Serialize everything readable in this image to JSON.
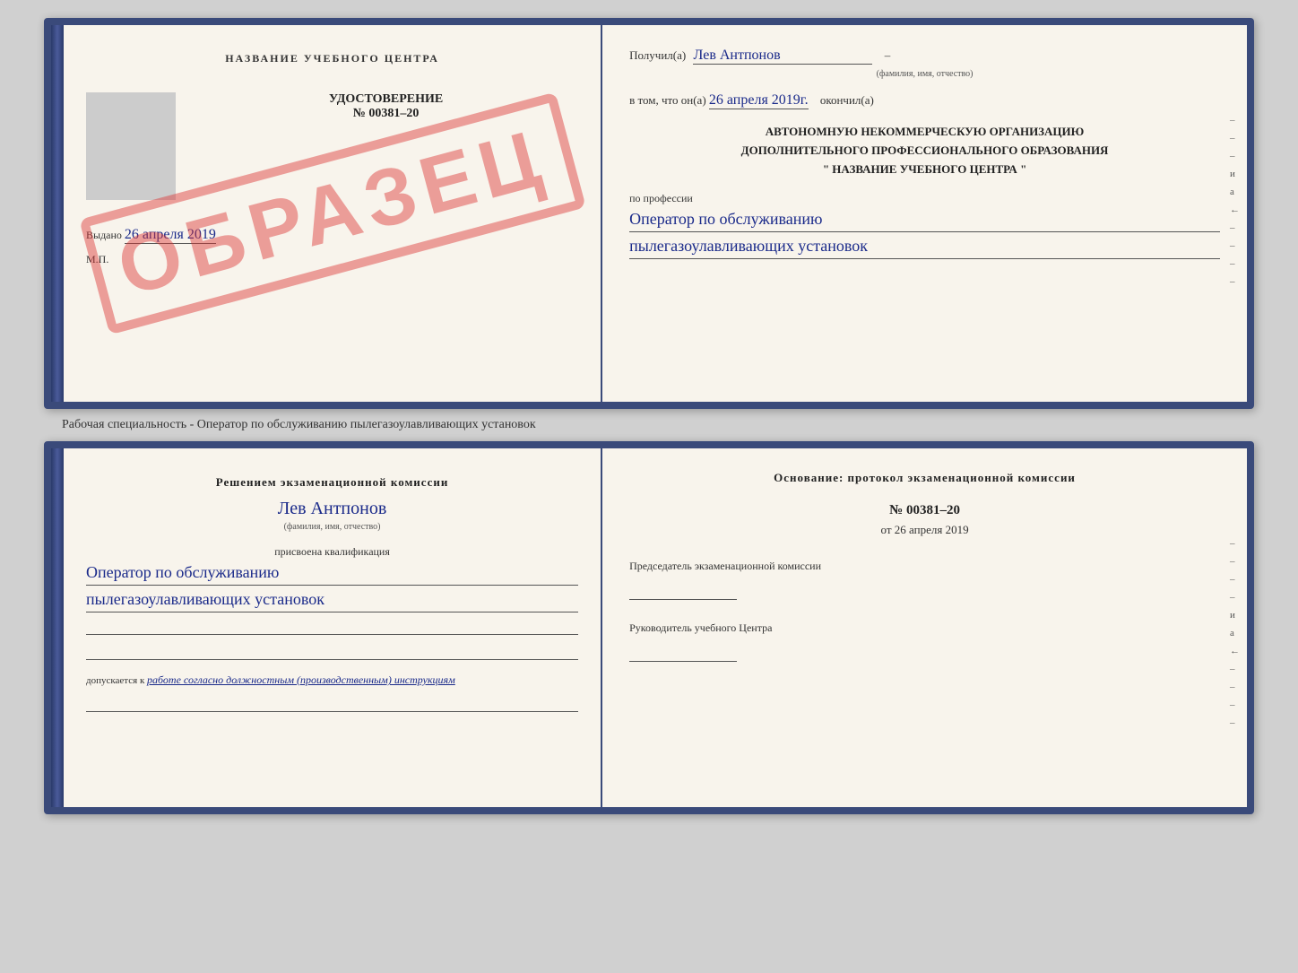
{
  "top_document": {
    "left_page": {
      "title": "НАЗВАНИЕ УЧЕБНОГО ЦЕНТРА",
      "stamp_text": "ОБРАЗЕЦ",
      "cert_type": "УДОСТОВЕРЕНИЕ",
      "cert_number": "№ 00381–20",
      "issued_label": "Выдано",
      "issued_date": "26 апреля 2019",
      "mp_label": "М.П."
    },
    "right_page": {
      "received_label": "Получил(а)",
      "fio_value": "Лев Антпонов",
      "fio_caption": "(фамилия, имя, отчество)",
      "completed_prefix": "в том, что он(а)",
      "completed_date": "26 апреля 2019г.",
      "completed_suffix": "окончил(а)",
      "org_line1": "АВТОНОМНУЮ НЕКОММЕРЧЕСКУЮ ОРГАНИЗАЦИЮ",
      "org_line2": "ДОПОЛНИТЕЛЬНОГО ПРОФЕССИОНАЛЬНОГО ОБРАЗОВАНИЯ",
      "org_line3": "\" НАЗВАНИЕ УЧЕБНОГО ЦЕНТРА \"",
      "profession_label": "по профессии",
      "profession_line1": "Оператор по обслуживанию",
      "profession_line2": "пылегазоулавливающих установок",
      "side_marks": [
        "–",
        "–",
        "–",
        "и",
        "a",
        "←",
        "–",
        "–",
        "–",
        "–"
      ]
    }
  },
  "between_label": "Рабочая специальность - Оператор по обслуживанию пылегазоулавливающих установок",
  "bottom_document": {
    "left_page": {
      "decision_label": "Решением экзаменационной комиссии",
      "fio_value": "Лев Антпонов",
      "fio_caption": "(фамилия, имя, отчество)",
      "qualification_label": "присвоена квалификация",
      "qualification_line1": "Оператор по обслуживанию",
      "qualification_line2": "пылегазоулавливающих установок",
      "allowed_prefix": "допускается к",
      "allowed_text": "работе согласно должностным (производственным) инструкциям"
    },
    "right_page": {
      "basis_label": "Основание: протокол экзаменационной комиссии",
      "protocol_number": "№ 00381–20",
      "protocol_date_prefix": "от",
      "protocol_date": "26 апреля 2019",
      "chairman_label": "Председатель экзаменационной комиссии",
      "director_label": "Руководитель учебного Центра",
      "side_marks": [
        "–",
        "–",
        "–",
        "–",
        "и",
        "a",
        "←",
        "–",
        "–",
        "–",
        "–"
      ]
    }
  }
}
